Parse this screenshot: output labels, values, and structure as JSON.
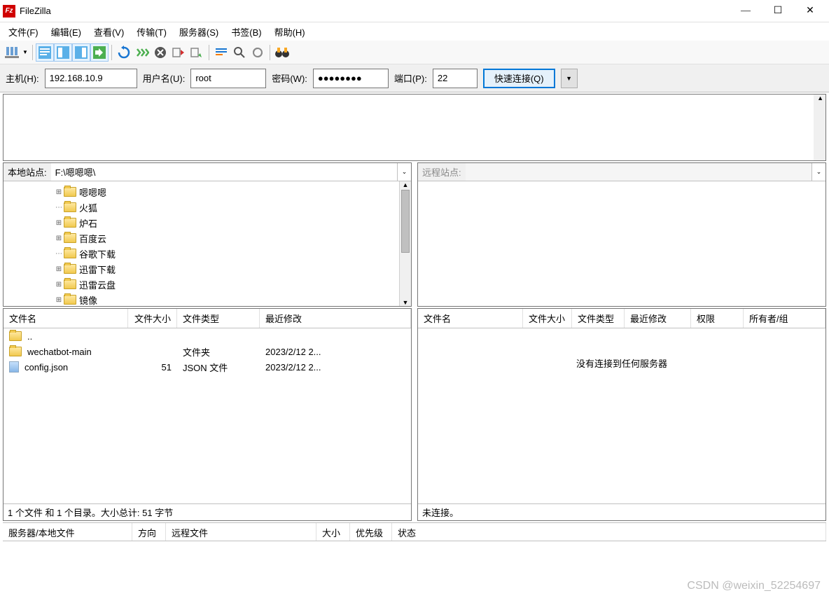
{
  "window": {
    "title": "FileZilla"
  },
  "menu": {
    "file": "文件(F)",
    "edit": "编辑(E)",
    "view": "查看(V)",
    "transfer": "传输(T)",
    "server": "服务器(S)",
    "bookmarks": "书签(B)",
    "help": "帮助(H)"
  },
  "quickconnect": {
    "host_label": "主机(H):",
    "host": "192.168.10.9",
    "user_label": "用户名(U):",
    "user": "root",
    "pass_label": "密码(W):",
    "pass": "●●●●●●●●",
    "port_label": "端口(P):",
    "port": "22",
    "button": "快速连接(Q)"
  },
  "local": {
    "label": "本地站点:",
    "path": "F:\\嗯嗯嗯\\",
    "tree": [
      {
        "exp": "⊞",
        "name": "嗯嗯嗯"
      },
      {
        "exp": "…",
        "name": "火狐"
      },
      {
        "exp": "⊞",
        "name": "炉石"
      },
      {
        "exp": "⊞",
        "name": "百度云"
      },
      {
        "exp": "…",
        "name": "谷歌下载"
      },
      {
        "exp": "⊞",
        "name": "迅雷下载"
      },
      {
        "exp": "⊞",
        "name": "迅雷云盘"
      },
      {
        "exp": "⊞",
        "name": "镜像"
      }
    ],
    "columns": {
      "name": "文件名",
      "size": "文件大小",
      "type": "文件类型",
      "modified": "最近修改"
    },
    "rows": [
      {
        "icon": "folder",
        "name": "..",
        "size": "",
        "type": "",
        "modified": ""
      },
      {
        "icon": "folder",
        "name": "wechatbot-main",
        "size": "",
        "type": "文件夹",
        "modified": "2023/2/12 2..."
      },
      {
        "icon": "json",
        "name": "config.json",
        "size": "51",
        "type": "JSON 文件",
        "modified": "2023/2/12 2..."
      }
    ],
    "status": "1 个文件 和 1 个目录。大小总计: 51 字节"
  },
  "remote": {
    "label": "远程站点:",
    "columns": {
      "name": "文件名",
      "size": "文件大小",
      "type": "文件类型",
      "modified": "最近修改",
      "perm": "权限",
      "owner": "所有者/组"
    },
    "empty": "没有连接到任何服务器",
    "status": "未连接。"
  },
  "queue": {
    "columns": {
      "server": "服务器/本地文件",
      "dir": "方向",
      "remote": "远程文件",
      "size": "大小",
      "priority": "优先级",
      "status": "状态"
    }
  },
  "watermark": "CSDN @weixin_52254697"
}
